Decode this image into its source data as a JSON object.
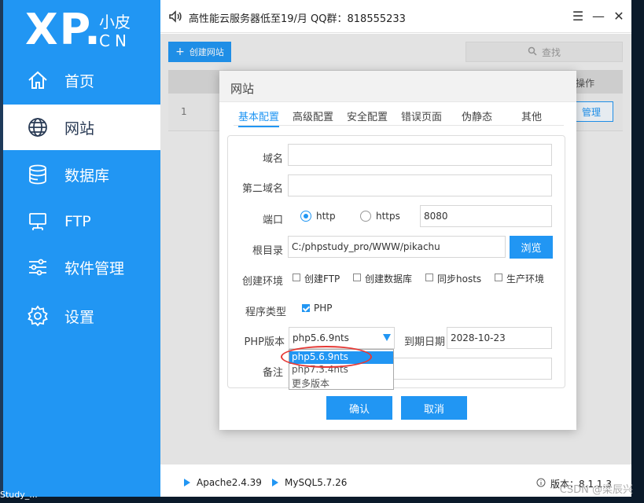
{
  "logo": {
    "main": "XP.",
    "cn_top": "小皮",
    "cn_bottom": "CN"
  },
  "sidebar": {
    "items": [
      {
        "label": "首页",
        "icon": "home-icon",
        "active": false
      },
      {
        "label": "网站",
        "icon": "globe-icon",
        "active": true
      },
      {
        "label": "数据库",
        "icon": "database-icon",
        "active": false
      },
      {
        "label": "FTP",
        "icon": "ftp-icon",
        "active": false
      },
      {
        "label": "软件管理",
        "icon": "sliders-icon",
        "active": false
      },
      {
        "label": "设置",
        "icon": "gear-icon",
        "active": false
      }
    ]
  },
  "topbar": {
    "notice": "高性能云服务器低至19/月   QQ群：818555233",
    "menu_glyph": "☰",
    "minimize_glyph": "—",
    "close_glyph": "✕"
  },
  "main": {
    "create_button": "创建网站",
    "create_glyph": "+",
    "search_placeholder": "查找",
    "table_header_op": "操作",
    "row_number": "1",
    "row_manage": "管理"
  },
  "dialog": {
    "title": "网站",
    "tabs": [
      "基本配置",
      "高级配置",
      "安全配置",
      "错误页面",
      "伪静态",
      "其他"
    ],
    "active_tab": "基本配置",
    "fields": {
      "domain_label": "域名",
      "domain_value": "",
      "second_domain_label": "第二域名",
      "second_domain_value": "",
      "port_label": "端口",
      "http_label": "http",
      "https_label": "https",
      "port_value": "8080",
      "root_label": "根目录",
      "root_value": "C:/phpstudy_pro/WWW/pikachu",
      "browse_button": "浏览",
      "env_label": "创建环境",
      "env_options": [
        "创建FTP",
        "创建数据库",
        "同步hosts",
        "生产环境"
      ],
      "program_type_label": "程序类型",
      "program_type_option": "PHP",
      "php_version_label": "PHP版本",
      "php_version_value": "php5.6.9nts",
      "expire_label": "到期日期",
      "expire_value": "2028-10-23",
      "note_label": "备注"
    },
    "dropdown_options": [
      "php5.6.9nts",
      "php7.3.4nts",
      "更多版本"
    ],
    "ok_button": "确认",
    "cancel_button": "取消"
  },
  "footer": {
    "apache": "Apache2.4.39",
    "mysql": "MySQL5.7.26",
    "version": "版本：8.1.1.3"
  },
  "desktop": {
    "taskbar_text": "Study_...",
    "watermark": "CSDN @梁辰兴"
  },
  "colors": {
    "accent": "#2196f3",
    "highlight_ring": "#e53935"
  }
}
